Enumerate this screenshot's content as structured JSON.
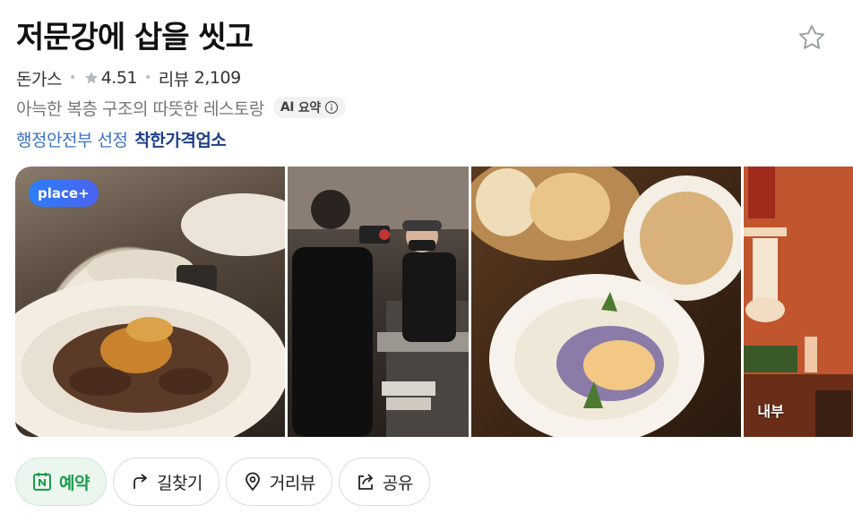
{
  "place": {
    "name": "저문강에 삽을 씻고",
    "category": "돈가스",
    "rating": "4.51",
    "review_label": "리뷰",
    "review_count": "2,109",
    "description": "아늑한 복층 구조의 따뜻한 레스토랑",
    "ai_chip_label": "AI",
    "ai_chip_text": "요약",
    "gov_label": "행정안전부 선정",
    "gov_badge": "착한가격업소"
  },
  "gallery": {
    "badge": "place+",
    "photo4_label": "내부"
  },
  "actions": [
    {
      "label": "예약",
      "icon": "naver-booking-icon"
    },
    {
      "label": "길찾기",
      "icon": "directions-arrow-icon"
    },
    {
      "label": "거리뷰",
      "icon": "location-pin-icon"
    },
    {
      "label": "공유",
      "icon": "share-icon"
    }
  ],
  "colors": {
    "reserve_green": "#1b9c4b",
    "link_blue": "#3b73c4",
    "badge_blue": "#2c7ef8"
  }
}
